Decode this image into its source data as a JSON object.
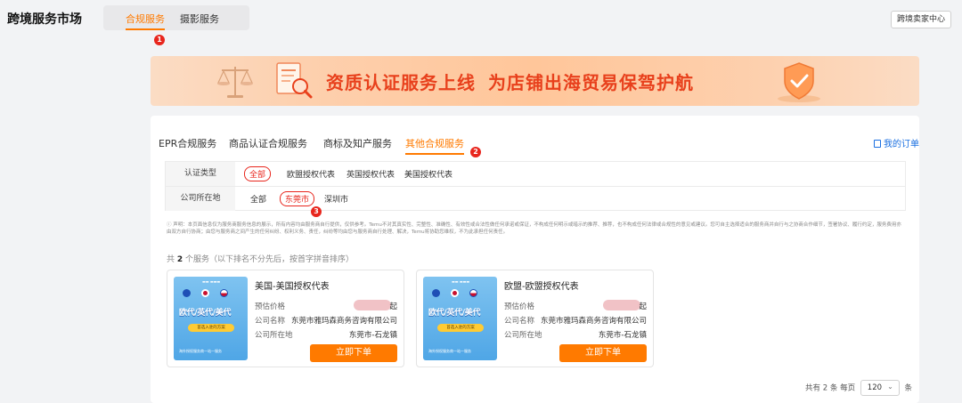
{
  "app": {
    "title": "跨境服务市场",
    "seller_center": "跨境卖家中心"
  },
  "nav": {
    "tabs": [
      {
        "label": "合规服务",
        "active": true
      },
      {
        "label": "摄影服务",
        "active": false
      }
    ]
  },
  "markers": [
    "1",
    "2",
    "3"
  ],
  "banner": {
    "headline": "资质认证服务上线",
    "subline": "为店铺出海贸易保驾护航"
  },
  "categories": [
    {
      "label": "EPR合规服务",
      "active": false
    },
    {
      "label": "商品认证合规服务",
      "active": false
    },
    {
      "label": "商标及知产服务",
      "active": false
    },
    {
      "label": "其他合规服务",
      "active": true
    }
  ],
  "my_orders": "我的订单",
  "filters": {
    "type": {
      "label": "认证类型",
      "options": [
        "全部",
        "欧盟授权代表",
        "英国授权代表",
        "美国授权代表"
      ],
      "selected": "全部"
    },
    "location": {
      "label": "公司所在地",
      "options": [
        "全部",
        "东莞市",
        "深圳市"
      ],
      "selected": "东莞市"
    }
  },
  "disclaimer": "ⓘ 声明：本页面信息仅为服务商服务信息的展示，所有内容均由服务商自行提供，仅供参考。Temu不对其真实性、完整性、准确性、有效性或合法性做任何承诺或保证，不构成任何明示或暗示的推荐、推荐，也不构成任何法律或合规性的意见或建议。您可自主选择适合的服务商并自行与之协商合作细节，签署协议、履行约定，服务费用亦由双方自行协商；由您与服务商之间产生的任何纠纷、权利义务、责任，纠纷等均由您与服务商自行处理、解决，Temu将协助您维权，不为此承担任何责任。",
  "results": {
    "prefix": "共",
    "count": "2",
    "suffix": "个服务（以下排名不分先后，按首字拼音排序）"
  },
  "cards": [
    {
      "title": "美国-美国授权代表",
      "image_slogan": "欧代/英代/美代",
      "image_pill": "首选入驻的方案",
      "image_footer": "海外授权服务商一站一服务",
      "price_label": "预估价格",
      "price_suffix": "起",
      "company_label": "公司名称",
      "company": "东莞市雅玛森商务咨询有限公司",
      "location_label": "公司所在地",
      "location": "东莞市-石龙镇",
      "buy_label": "立即下单"
    },
    {
      "title": "欧盟-欧盟授权代表",
      "image_slogan": "欧代/英代/美代",
      "image_pill": "首选入驻的方案",
      "image_footer": "海外授权服务商一站一服务",
      "price_label": "预估价格",
      "price_suffix": "起",
      "company_label": "公司名称",
      "company": "东莞市雅玛森商务咨询有限公司",
      "location_label": "公司所在地",
      "location": "东莞市-石龙镇",
      "buy_label": "立即下单"
    }
  ],
  "pagination": {
    "total_text": "共有 2 条",
    "per_page_label": "每页",
    "per_page_value": "120",
    "unit": "条"
  },
  "colors": {
    "accent": "#ff7a00",
    "marker": "#e8261d",
    "link": "#1a6fe0"
  }
}
